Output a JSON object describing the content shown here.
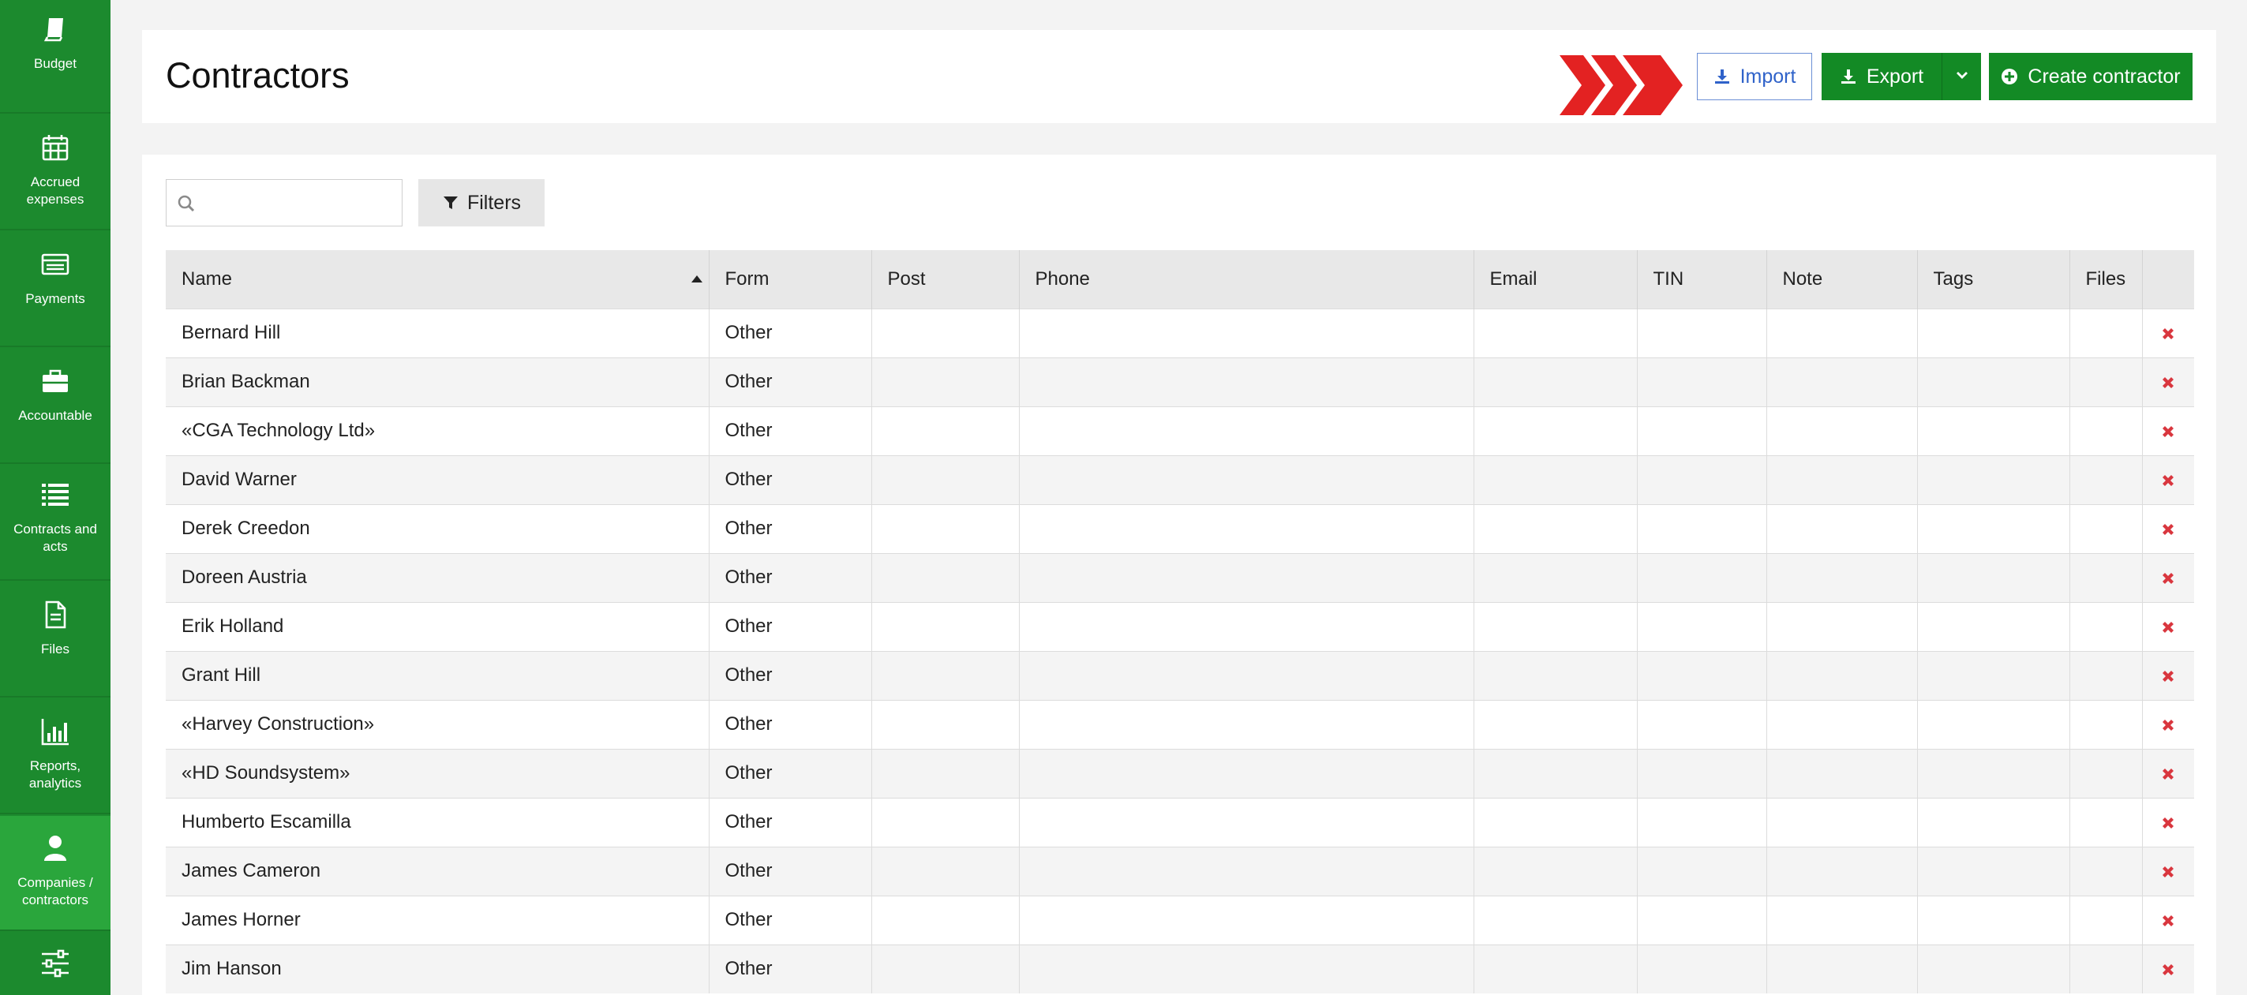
{
  "colors": {
    "sidebar": "#1c8a2e",
    "sidebar_active": "#2aa63c",
    "primary_button": "#138a25",
    "import_text": "#2f62c9",
    "chevron_red": "#e32222",
    "delete_red": "#d9363e"
  },
  "sidebar": {
    "items": [
      {
        "label": "Budget",
        "icon": "book-icon"
      },
      {
        "label": "Accrued expenses",
        "icon": "calendar-icon"
      },
      {
        "label": "Payments",
        "icon": "card-icon"
      },
      {
        "label": "Accountable",
        "icon": "briefcase-icon"
      },
      {
        "label": "Contracts and acts",
        "icon": "list-icon"
      },
      {
        "label": "Files",
        "icon": "file-icon"
      },
      {
        "label": "Reports, analytics",
        "icon": "bar-chart-icon"
      },
      {
        "label": "Companies / contractors",
        "icon": "user-icon",
        "active": true
      },
      {
        "label": "",
        "icon": "sliders-icon"
      }
    ]
  },
  "header": {
    "title": "Contractors",
    "import_label": "Import",
    "export_label": "Export",
    "create_label": "Create contractor"
  },
  "toolbar": {
    "search_value": "",
    "filters_label": "Filters"
  },
  "table": {
    "columns": [
      "Name",
      "Form",
      "Post",
      "Phone",
      "Email",
      "TIN",
      "Note",
      "Tags",
      "Files",
      ""
    ],
    "sorted_column": "Name",
    "rows": [
      {
        "name": "Bernard Hill",
        "form": "Other"
      },
      {
        "name": "Brian Backman",
        "form": "Other"
      },
      {
        "name": "«CGA Technology Ltd»",
        "form": "Other"
      },
      {
        "name": "David Warner",
        "form": "Other"
      },
      {
        "name": "Derek Creedon",
        "form": "Other"
      },
      {
        "name": "Doreen Austria",
        "form": "Other"
      },
      {
        "name": "Erik Holland",
        "form": "Other"
      },
      {
        "name": "Grant Hill",
        "form": "Other"
      },
      {
        "name": "«Harvey Construction»",
        "form": "Other"
      },
      {
        "name": "«HD Soundsystem»",
        "form": "Other"
      },
      {
        "name": "Humberto Escamilla",
        "form": "Other"
      },
      {
        "name": "James Cameron",
        "form": "Other"
      },
      {
        "name": "James Horner",
        "form": "Other"
      },
      {
        "name": "Jim Hanson",
        "form": "Other"
      }
    ]
  }
}
